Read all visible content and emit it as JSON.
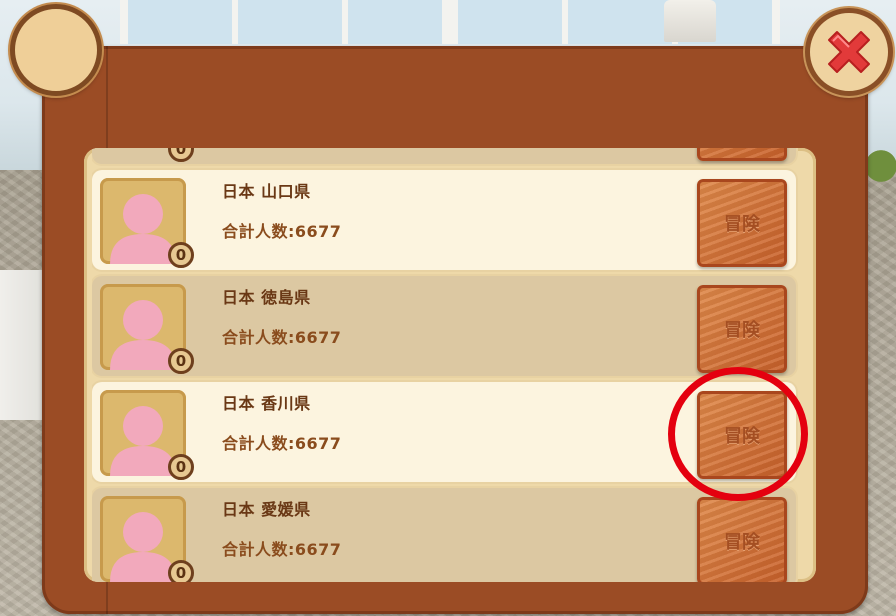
{
  "background": {
    "scene": "room-interior"
  },
  "header": {
    "avatar_icon": "avatar-circle-icon",
    "close_icon": "red-x-close-icon"
  },
  "list": {
    "partial_row": {
      "level": "0"
    },
    "rows": [
      {
        "title": "日本 山口県",
        "count": "合計人数:6677",
        "level": "0",
        "button": "冒険"
      },
      {
        "title": "日本 徳島県",
        "count": "合計人数:6677",
        "level": "0",
        "button": "冒険"
      },
      {
        "title": "日本 香川県",
        "count": "合計人数:6677",
        "level": "0",
        "button": "冒険"
      },
      {
        "title": "日本 愛媛県",
        "count": "合計人数:6677",
        "level": "0",
        "button": "冒険"
      }
    ]
  },
  "annotation": {
    "highlight_color": "#e4000f"
  },
  "colors": {
    "panel": "#9b4c25",
    "row_light": "#fcf4df",
    "row_dark": "#dcc8a2",
    "button_wood": "#d8763a",
    "text_brown": "#6a3815"
  }
}
